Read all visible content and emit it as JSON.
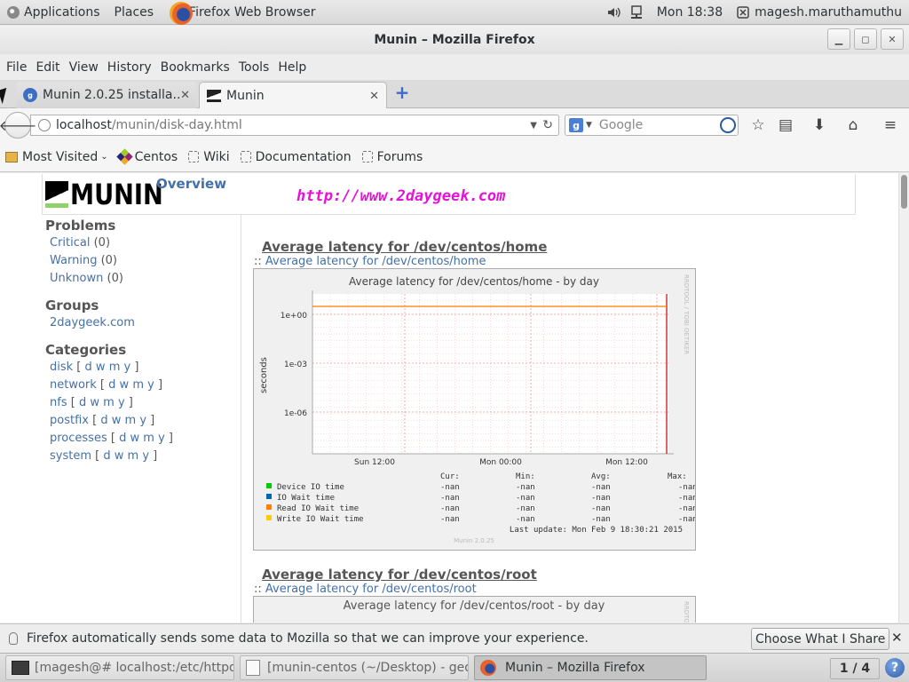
{
  "panel": {
    "applications": "Applications",
    "places": "Places",
    "active_app": "Firefox Web Browser",
    "clock": "Mon 18:38",
    "user": "magesh.maruthamuthu"
  },
  "window": {
    "title": "Munin – Mozilla Firefox"
  },
  "menubar": {
    "items": [
      "File",
      "Edit",
      "View",
      "History",
      "Bookmarks",
      "Tools",
      "Help"
    ]
  },
  "tabs": [
    {
      "label": "Munin 2.0.25 installa...",
      "favicon": "2g",
      "active": false
    },
    {
      "label": "Munin",
      "favicon": "munin",
      "active": true
    }
  ],
  "navbar": {
    "url_host": "localhost",
    "url_path": "/munin/disk-day.html",
    "search_placeholder": "Google",
    "search_engine_icon": "g"
  },
  "bookmarks": {
    "items": [
      {
        "label": "Most Visited",
        "icon": "folder-icon",
        "dropdown": true
      },
      {
        "label": "Centos",
        "icon": "centos-icon"
      },
      {
        "label": "Wiki",
        "icon": "page-icon"
      },
      {
        "label": "Documentation",
        "icon": "page-icon"
      },
      {
        "label": "Forums",
        "icon": "page-icon"
      }
    ]
  },
  "munin": {
    "logo_text": "MUNIN",
    "overview_link": "Overview",
    "site_url": "http://www.2daygeek.com",
    "problems": {
      "heading": "Problems",
      "items": [
        {
          "label": "Critical",
          "count": "(0)"
        },
        {
          "label": "Warning",
          "count": "(0)"
        },
        {
          "label": "Unknown",
          "count": "(0)"
        }
      ]
    },
    "groups": {
      "heading": "Groups",
      "items": [
        "2daygeek.com"
      ]
    },
    "categories": {
      "heading": "Categories",
      "periods": [
        "d",
        "w",
        "m",
        "y"
      ],
      "items": [
        "disk",
        "network",
        "nfs",
        "postfix",
        "processes",
        "system"
      ]
    }
  },
  "graphs": [
    {
      "heading": "Average latency for /dev/centos/home",
      "sublink_prefix": "::",
      "sublink": "Average latency for /dev/centos/home",
      "chart_title": "Average latency for /dev/centos/home - by day",
      "side_label": "RRDTOOL / TOBI OETIKER",
      "ylabel": "seconds",
      "yticks": [
        "1e+00",
        "1e-03",
        "1e-06"
      ],
      "xticks": [
        "Sun 12:00",
        "Mon 00:00",
        "Mon 12:00"
      ],
      "legend_headers": [
        "Cur:",
        "Min:",
        "Avg:",
        "Max:"
      ],
      "legend": [
        {
          "name": "Device IO time",
          "color": "#00cc00",
          "cur": "-nan",
          "min": "-nan",
          "avg": "-nan",
          "max": "-nan"
        },
        {
          "name": "IO Wait time",
          "color": "#0066b3",
          "cur": "-nan",
          "min": "-nan",
          "avg": "-nan",
          "max": "-nan"
        },
        {
          "name": "Read IO Wait time",
          "color": "#ff8000",
          "cur": "-nan",
          "min": "-nan",
          "avg": "-nan",
          "max": "-nan"
        },
        {
          "name": "Write IO Wait time",
          "color": "#ffcc00",
          "cur": "-nan",
          "min": "-nan",
          "avg": "-nan",
          "max": "-nan"
        }
      ],
      "last_update": "Last update:  Mon Feb  9 18:30:21 2015",
      "footer": "Munin 2.0.25"
    },
    {
      "heading": "Average latency for /dev/centos/root",
      "sublink_prefix": "::",
      "sublink": "Average latency for /dev/centos/root",
      "chart_title": "Average latency for /dev/centos/root - by day",
      "side_label": "RRDTOOL / TOBI OETIKER"
    }
  ],
  "notification": {
    "text": "Firefox automatically sends some data to Mozilla so that we can improve your experience.",
    "button": "Choose What I Share"
  },
  "taskbar": {
    "tasks": [
      {
        "label": "[magesh@# localhost:/etc/httpd...",
        "icon": "terminal-icon",
        "active": false
      },
      {
        "label": "[munin-centos (~/Desktop) - ged...",
        "icon": "gedit-icon",
        "active": false
      },
      {
        "label": "Munin – Mozilla Firefox",
        "icon": "firefox-icon",
        "active": true
      }
    ],
    "workspace": "1 / 4"
  }
}
